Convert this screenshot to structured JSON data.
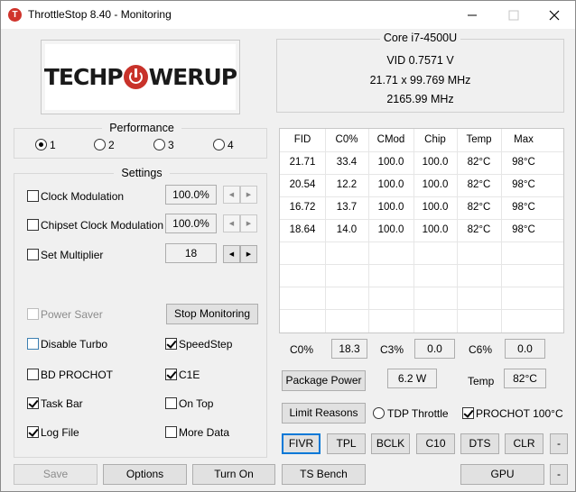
{
  "window": {
    "title": "ThrottleStop 8.40 - Monitoring",
    "icon_letter": "T"
  },
  "logo": {
    "left": "TECHP",
    "right": "WERUP"
  },
  "cpu_info": {
    "model": "Core i7-4500U",
    "vid": "VID  0.7571 V",
    "multiplier_bclk": "21.71 x 99.769 MHz",
    "frequency": "2165.99 MHz"
  },
  "performance": {
    "title": "Performance",
    "options": [
      "1",
      "2",
      "3",
      "4"
    ],
    "selected_index": 0
  },
  "settings": {
    "title": "Settings",
    "clock_modulation": {
      "label": "Clock Modulation",
      "value": "100.0%",
      "checked": false
    },
    "chipset_clock_modulation": {
      "label": "Chipset Clock Modulation",
      "value": "100.0%",
      "checked": false
    },
    "set_multiplier": {
      "label": "Set Multiplier",
      "value": "18",
      "checked": false
    },
    "spin_left": "◀",
    "spin_right": "▶"
  },
  "options_left": {
    "power_saver": {
      "label": "Power Saver",
      "checked": false,
      "disabled": true
    },
    "disable_turbo": {
      "label": "Disable Turbo",
      "checked": false
    },
    "bd_prochot": {
      "label": "BD PROCHOT",
      "checked": false
    },
    "task_bar": {
      "label": "Task Bar",
      "checked": true
    },
    "log_file": {
      "label": "Log File",
      "checked": true
    }
  },
  "options_right": {
    "speedstep": {
      "label": "SpeedStep",
      "checked": true
    },
    "c1e": {
      "label": "C1E",
      "checked": true
    },
    "on_top": {
      "label": "On Top",
      "checked": false
    },
    "more_data": {
      "label": "More Data",
      "checked": false
    }
  },
  "stop_monitoring_label": "Stop Monitoring",
  "core_table": {
    "headers": [
      "FID",
      "C0%",
      "CMod",
      "Chip",
      "Temp",
      "Max"
    ],
    "rows": [
      [
        "21.71",
        "33.4",
        "100.0",
        "100.0",
        "82°C",
        "98°C"
      ],
      [
        "20.54",
        "12.2",
        "100.0",
        "100.0",
        "82°C",
        "98°C"
      ],
      [
        "16.72",
        "13.7",
        "100.0",
        "100.0",
        "82°C",
        "98°C"
      ],
      [
        "18.64",
        "14.0",
        "100.0",
        "100.0",
        "82°C",
        "98°C"
      ]
    ]
  },
  "cstates": {
    "c0_label": "C0%",
    "c0_value": "18.3",
    "c3_label": "C3%",
    "c3_value": "0.0",
    "c6_label": "C6%",
    "c6_value": "0.0"
  },
  "power": {
    "package_power_label": "Package Power",
    "package_power_value": "6.2 W",
    "temp_label": "Temp",
    "temp_value": "82°C"
  },
  "limits": {
    "limit_reasons_label": "Limit Reasons",
    "tdp_throttle_label": "TDP Throttle",
    "tdp_throttle_selected": false,
    "prochot_label": "PROCHOT 100°C",
    "prochot_checked": true
  },
  "tool_buttons": [
    "FIVR",
    "TPL",
    "BCLK",
    "C10",
    "DTS",
    "CLR"
  ],
  "minus_label": "-",
  "bottom_buttons": {
    "save": "Save",
    "options": "Options",
    "turn_on": "Turn On",
    "ts_bench": "TS Bench",
    "gpu": "GPU"
  }
}
